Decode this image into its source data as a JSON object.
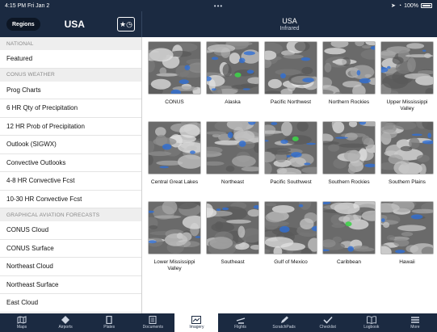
{
  "status_bar": {
    "time_date": "4:15 PM  Fri Jan 2",
    "battery": "100%"
  },
  "sidebar_header": {
    "regions_label": "Regions",
    "title": "USA"
  },
  "main_header": {
    "title": "USA",
    "subtitle": "Infrared"
  },
  "sidebar": {
    "sections": [
      {
        "title": "NATIONAL",
        "items": [
          "Featured"
        ]
      },
      {
        "title": "CONUS WEATHER",
        "items": [
          "Prog Charts",
          "6 HR Qty of Precipitation",
          "12 HR Prob of Precipitation",
          "Outlook (SIGWX)",
          "Convective Outlooks",
          "4-8 HR Convective Fcst",
          "10-30 HR Convective Fcst"
        ]
      },
      {
        "title": "GRAPHICAL AVIATION FORECASTS",
        "items": [
          "CONUS Cloud",
          "CONUS Surface",
          "Northeast Cloud",
          "Northeast Surface",
          "East Cloud"
        ]
      }
    ]
  },
  "tiles": [
    "CONUS",
    "Alaska",
    "Pacific Northwest",
    "Northern Rockies",
    "Upper Mississippi Valley",
    "Central Great Lakes",
    "Northeast",
    "Pacific Southwest",
    "Southern Rockies",
    "Southern Plains",
    "Lower Mississippi Valley",
    "Southeast",
    "Gulf of Mexico",
    "Caribbean",
    "Hawaii"
  ],
  "tabs": [
    {
      "label": "Maps",
      "icon": "map-icon",
      "active": false
    },
    {
      "label": "Airports",
      "icon": "airport-icon",
      "active": false
    },
    {
      "label": "Plates",
      "icon": "plates-icon",
      "active": false
    },
    {
      "label": "Documents",
      "icon": "documents-icon",
      "active": false
    },
    {
      "label": "Imagery",
      "icon": "imagery-icon",
      "active": true
    },
    {
      "label": "Flights",
      "icon": "flights-icon",
      "active": false
    },
    {
      "label": "ScratchPads",
      "icon": "scratchpad-icon",
      "active": false
    },
    {
      "label": "Checklist",
      "icon": "checklist-icon",
      "active": false
    },
    {
      "label": "Logbook",
      "icon": "logbook-icon",
      "active": false
    },
    {
      "label": "More",
      "icon": "more-icon",
      "active": false
    }
  ],
  "colors": {
    "header_bg": "#1b2a41",
    "section_bg": "#eeeeee",
    "active_tab_bg": "#ffffff"
  }
}
